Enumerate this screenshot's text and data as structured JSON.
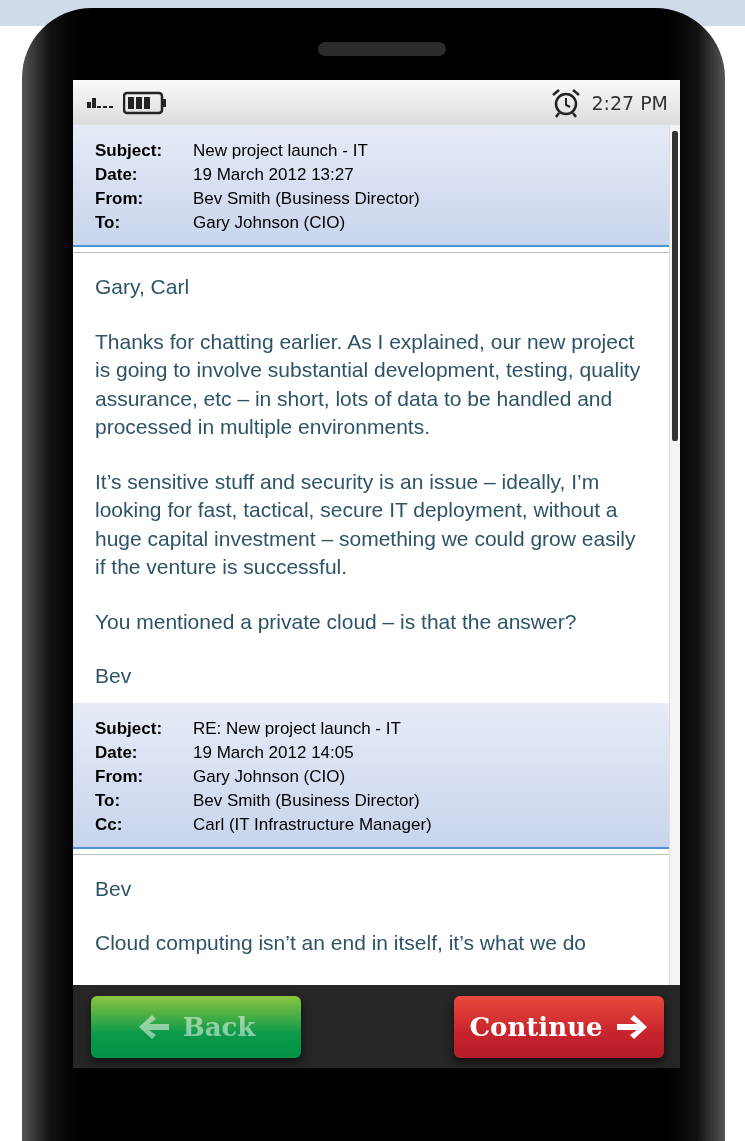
{
  "status_bar": {
    "time": "2:27 PM"
  },
  "emails": [
    {
      "fields": [
        {
          "label": "Subject:",
          "value": "New project launch - IT"
        },
        {
          "label": "Date:",
          "value": "19 March 2012 13:27"
        },
        {
          "label": "From:",
          "value": "Bev Smith (Business Director)"
        },
        {
          "label": "To:",
          "value": "Gary Johnson (CIO)"
        }
      ],
      "paragraphs": [
        "Gary, Carl",
        "Thanks for chatting earlier. As I explained, our new project is going to involve substantial development, testing, quality assurance, etc – in short, lots of data to be handled and processed in multiple environments.",
        "It’s sensitive stuff and security is an issue – ideally, I’m looking for fast, tactical, secure IT deployment, without a huge capital investment – something we could grow easily if the venture is successful.",
        "You mentioned a private cloud – is that the answer?",
        "Bev"
      ]
    },
    {
      "fields": [
        {
          "label": "Subject:",
          "value": "RE: New project launch - IT"
        },
        {
          "label": "Date:",
          "value": "19 March 2012 14:05"
        },
        {
          "label": "From:",
          "value": "Gary Johnson (CIO)"
        },
        {
          "label": "To:",
          "value": "Bev Smith (Business Director)"
        },
        {
          "label": "Cc:",
          "value": "Carl (IT Infrastructure Manager)"
        }
      ],
      "paragraphs": [
        "Bev",
        "Cloud computing isn’t an end in itself, it’s what we do"
      ]
    }
  ],
  "buttons": [
    {
      "kind": "back",
      "label": "Back",
      "disabled": true
    },
    {
      "kind": "continue",
      "label": "Continue",
      "disabled": false
    }
  ]
}
